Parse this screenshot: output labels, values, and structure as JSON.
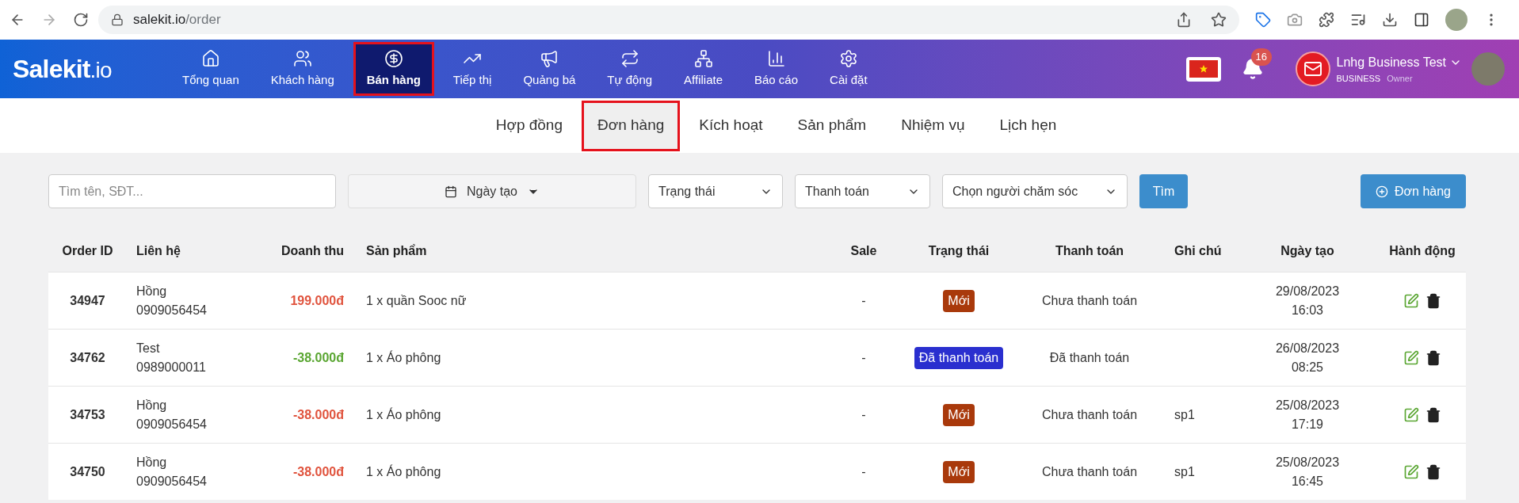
{
  "browser": {
    "url_host": "salekit.io",
    "url_path": "/order"
  },
  "header": {
    "logo_main": "Salekit",
    "logo_suffix": ".io",
    "nav": [
      {
        "label": "Tổng quan",
        "selected": false
      },
      {
        "label": "Khách hàng",
        "selected": false
      },
      {
        "label": "Bán hàng",
        "selected": true
      },
      {
        "label": "Tiếp thị",
        "selected": false
      },
      {
        "label": "Quảng bá",
        "selected": false
      },
      {
        "label": "Tự động",
        "selected": false
      },
      {
        "label": "Affiliate",
        "selected": false
      },
      {
        "label": "Báo cáo",
        "selected": false
      },
      {
        "label": "Cài đặt",
        "selected": false
      }
    ],
    "notification_count": "16",
    "user_name": "Lnhg Business Test",
    "user_plan": "BUSINESS",
    "user_role": "Owner"
  },
  "subnav": [
    {
      "label": "Hợp đồng",
      "selected": false
    },
    {
      "label": "Đơn hàng",
      "selected": true
    },
    {
      "label": "Kích hoạt",
      "selected": false
    },
    {
      "label": "Sản phẩm",
      "selected": false
    },
    {
      "label": "Nhiệm vụ",
      "selected": false
    },
    {
      "label": "Lịch hẹn",
      "selected": false
    }
  ],
  "filters": {
    "search_placeholder": "Tìm tên, SĐT...",
    "date_label": "Ngày tạo",
    "status_select": "Trạng thái",
    "payment_select": "Thanh toán",
    "caretaker_select": "Chọn người chăm sóc",
    "search_button": "Tìm",
    "add_button": "Đơn hàng"
  },
  "table": {
    "columns": [
      "Order ID",
      "Liên hệ",
      "Doanh thu",
      "Sản phẩm",
      "Sale",
      "Trạng thái",
      "Thanh toán",
      "Ghi chú",
      "Ngày tạo",
      "Hành động"
    ],
    "rows": [
      {
        "id": "34947",
        "contact": "Hồng",
        "phone": "0909056454",
        "revenue": "199.000đ",
        "kind": "unpaid",
        "product": "1 x quần Sooc nữ",
        "sale": "-",
        "status": "Mới",
        "color": "#a9390b",
        "payment": "Chưa thanh toán",
        "note": "",
        "date": "29/08/2023",
        "time": "16:03"
      },
      {
        "id": "34762",
        "contact": "Test",
        "phone": "0989000011",
        "revenue": "-38.000đ",
        "kind": "paid",
        "product": "1 x Áo phông",
        "sale": "-",
        "status": "Đã thanh toán",
        "color": "#2a2fcf",
        "payment": "Đã thanh toán",
        "note": "",
        "date": "26/08/2023",
        "time": "08:25"
      },
      {
        "id": "34753",
        "contact": "Hồng",
        "phone": "0909056454",
        "revenue": "-38.000đ",
        "kind": "unpaid",
        "product": "1 x Áo phông",
        "sale": "-",
        "status": "Mới",
        "color": "#a9390b",
        "payment": "Chưa thanh toán",
        "note": "sp1",
        "date": "25/08/2023",
        "time": "17:19"
      },
      {
        "id": "34750",
        "contact": "Hồng",
        "phone": "0909056454",
        "revenue": "-38.000đ",
        "kind": "unpaid",
        "product": "1 x Áo phông",
        "sale": "-",
        "status": "Mới",
        "color": "#a9390b",
        "payment": "Chưa thanh toán",
        "note": "sp1",
        "date": "25/08/2023",
        "time": "16:45"
      }
    ]
  }
}
